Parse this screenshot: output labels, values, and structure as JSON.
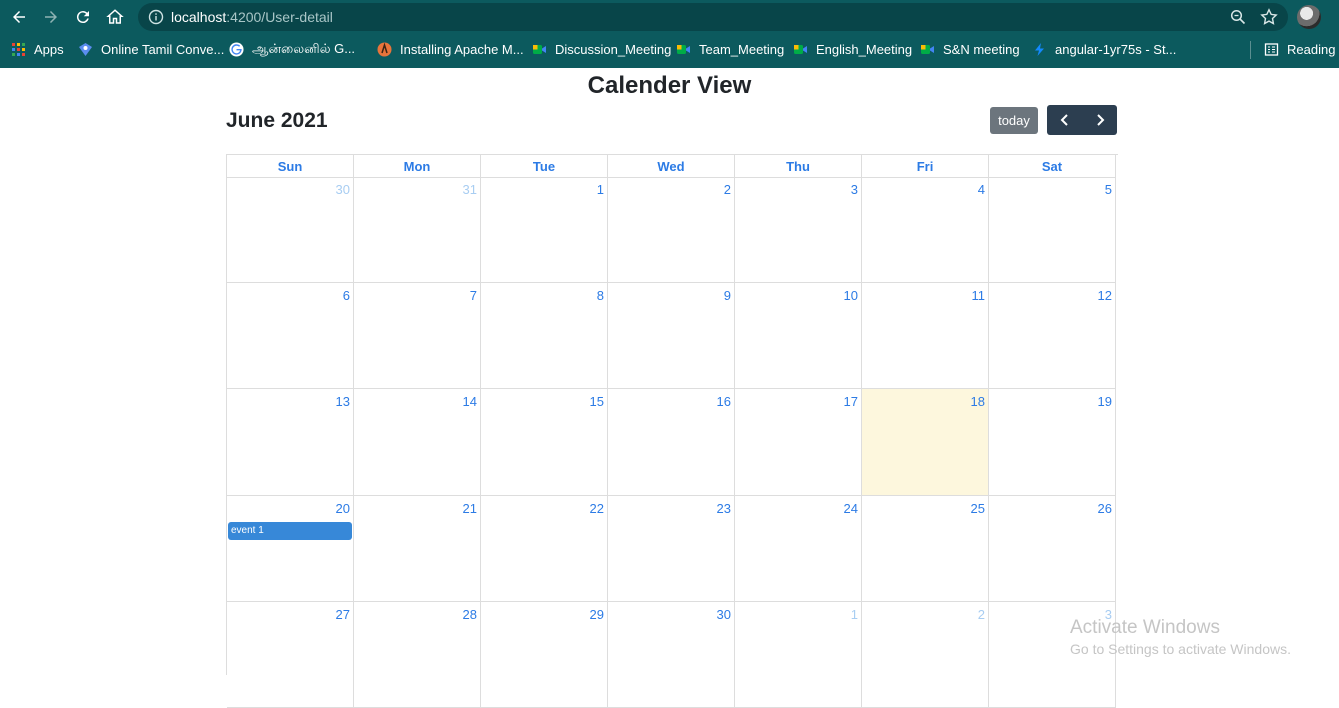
{
  "browser": {
    "url_host": "localhost",
    "url_path": ":4200/User-detail"
  },
  "bookmarks": [
    {
      "label": "Apps",
      "icon": "apps-grid-icon",
      "color": "#e94235"
    },
    {
      "label": "Online Tamil Conve...",
      "icon": "tamil-site-icon",
      "color": "#5b8def"
    },
    {
      "label": "ஆன்லைனில் G...",
      "icon": "google-icon",
      "color": "#ffffff"
    },
    {
      "label": "Installing Apache M...",
      "icon": "apache-icon",
      "color": "#e8743b"
    },
    {
      "label": "Discussion_Meeting",
      "icon": "google-meet-icon",
      "color": "#00ac47"
    },
    {
      "label": "Team_Meeting",
      "icon": "google-meet-icon",
      "color": "#00ac47"
    },
    {
      "label": "English_Meeting",
      "icon": "google-meet-icon",
      "color": "#00ac47"
    },
    {
      "label": "S&N meeting",
      "icon": "google-meet-icon",
      "color": "#00ac47"
    },
    {
      "label": "angular-1yr75s - St...",
      "icon": "stackblitz-icon",
      "color": "#1389fd"
    },
    {
      "label": "Reading li",
      "icon": "reading-list-icon",
      "color": "#ffffff"
    }
  ],
  "page": {
    "title": "Calender View"
  },
  "calendar": {
    "month_title": "June 2021",
    "today_label": "today",
    "weekdays": [
      "Sun",
      "Mon",
      "Tue",
      "Wed",
      "Thu",
      "Fri",
      "Sat"
    ],
    "weeks": [
      [
        {
          "n": "30",
          "other": true
        },
        {
          "n": "31",
          "other": true
        },
        {
          "n": "1"
        },
        {
          "n": "2"
        },
        {
          "n": "3"
        },
        {
          "n": "4"
        },
        {
          "n": "5"
        }
      ],
      [
        {
          "n": "6"
        },
        {
          "n": "7"
        },
        {
          "n": "8"
        },
        {
          "n": "9"
        },
        {
          "n": "10"
        },
        {
          "n": "11"
        },
        {
          "n": "12"
        }
      ],
      [
        {
          "n": "13"
        },
        {
          "n": "14"
        },
        {
          "n": "15"
        },
        {
          "n": "16"
        },
        {
          "n": "17"
        },
        {
          "n": "18",
          "today": true
        },
        {
          "n": "19"
        }
      ],
      [
        {
          "n": "20",
          "event": "event 1"
        },
        {
          "n": "21"
        },
        {
          "n": "22"
        },
        {
          "n": "23"
        },
        {
          "n": "24"
        },
        {
          "n": "25"
        },
        {
          "n": "26"
        }
      ],
      [
        {
          "n": "27"
        },
        {
          "n": "28"
        },
        {
          "n": "29"
        },
        {
          "n": "30"
        },
        {
          "n": "1",
          "other": true
        },
        {
          "n": "2",
          "other": true
        },
        {
          "n": "3",
          "other": true
        }
      ]
    ],
    "colors": {
      "header_text": "#2c7be5",
      "today_bg": "#fdf7dd",
      "event_bg": "#3788d8",
      "nav_button_bg": "#2c3e50",
      "today_button_bg": "#6c757d"
    }
  },
  "watermark": {
    "title": "Activate Windows",
    "subtitle": "Go to Settings to activate Windows."
  }
}
